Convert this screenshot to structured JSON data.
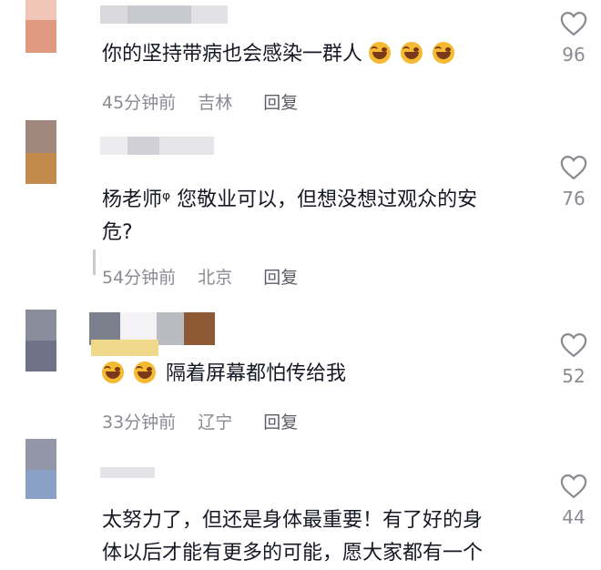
{
  "comments": [
    {
      "text": "你的坚持带病也会感染一群人",
      "emoji_count": 3,
      "time": "45分钟前",
      "location": "吉林",
      "reply": "回复",
      "likes": "96",
      "avatar_colors": [
        "#f1c6b8",
        "#e19a7f"
      ]
    },
    {
      "author": "杨老师",
      "author_badge": "ᵠ",
      "text_line1": "您敬业可以，但想没想过观众的安",
      "text_line2": "危?",
      "time": "54分钟前",
      "location": "北京",
      "reply": "回复",
      "likes": "76",
      "avatar_colors": [
        "#a0877e",
        "#c28a4c"
      ]
    },
    {
      "text": "隔着屏幕都怕传给我",
      "time": "33分钟前",
      "location": "辽宁",
      "reply": "回复",
      "likes": "52",
      "avatar_colors": [
        "#8a8d9c",
        "#6e7388"
      ]
    },
    {
      "text_line1": "太努力了，但还是身体最重要！有了好的身",
      "text_line2": "体以后才能有更多的可能，愿大家都有一个",
      "likes": "44",
      "avatar_colors": [
        "#9296a7",
        "#8aa0c4"
      ]
    }
  ],
  "icons": {
    "like": "heart-outline-icon",
    "emoji": "laughing-tears-emoji-icon"
  },
  "colors": {
    "text": "#161823",
    "meta": "#8a8b91",
    "heart": "#8a8b91"
  }
}
